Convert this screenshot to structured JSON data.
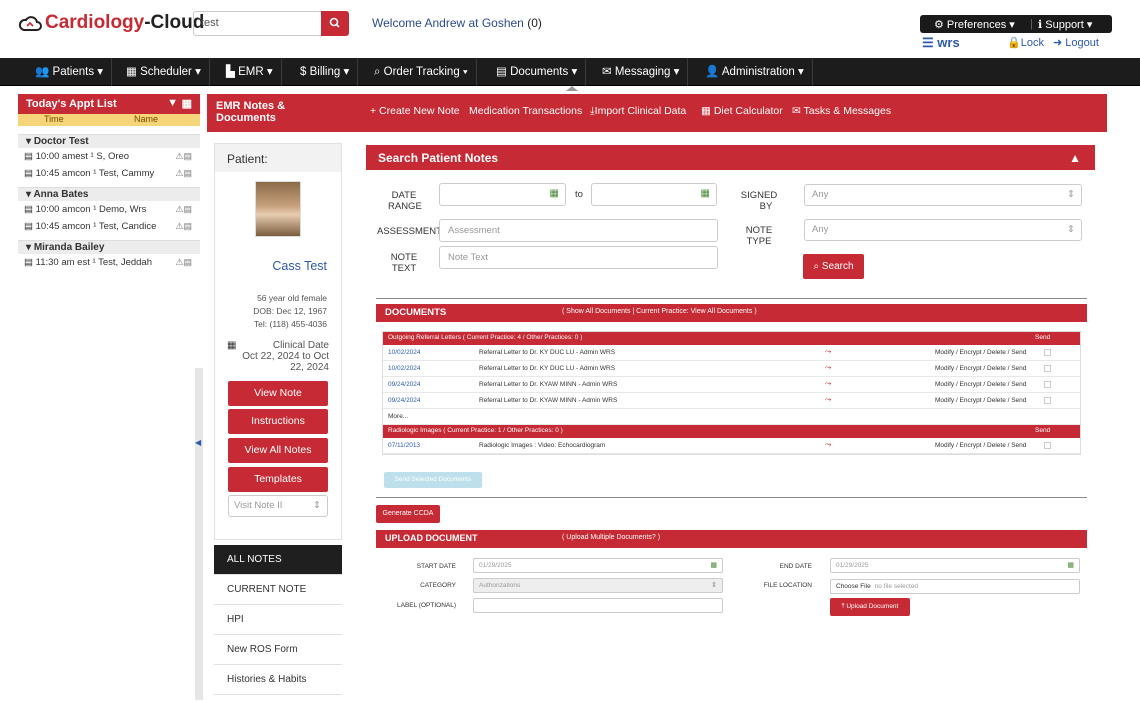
{
  "header": {
    "logo_part1": "Cardiology",
    "logo_part2": "-Cloud",
    "search_value": "test",
    "welcome": "Welcome Andrew at Goshen",
    "welcome_count": "(0)",
    "preferences": "Preferences",
    "support": "Support",
    "wrs": "wrs",
    "lock": "Lock",
    "logout": "Logout"
  },
  "nav": {
    "items": [
      {
        "label": "Patients",
        "icon": "patients-icon"
      },
      {
        "label": "Scheduler",
        "icon": "calendar-icon"
      },
      {
        "label": "EMR",
        "icon": "emr-icon"
      },
      {
        "label": "$ Billing",
        "icon": ""
      },
      {
        "label": "Order Tracking",
        "icon": "search-icon"
      },
      {
        "label": "Documents",
        "icon": "document-icon"
      },
      {
        "label": "Messaging",
        "icon": "envelope-icon"
      },
      {
        "label": "Administration",
        "icon": "user-icon"
      }
    ]
  },
  "appt": {
    "title": "Today's Appt List",
    "col_time": "Time",
    "col_name": "Name",
    "groups": [
      {
        "doctor": "Doctor Test",
        "rows": [
          "10:00 amest ¹ S, Oreo",
          "10:45 amcon ¹ Test, Cammy"
        ]
      },
      {
        "doctor": "Anna Bates",
        "rows": [
          "10:00 amcon ¹ Demo, Wrs",
          "10:45 amcon ¹ Test, Candice"
        ]
      },
      {
        "doctor": "Miranda Bailey",
        "rows": [
          "11:30 am est ¹ Test, Jeddah"
        ]
      }
    ]
  },
  "emr": {
    "title_line1": "EMR Notes &",
    "title_line2": "Documents",
    "create_note": "+ Create New Note",
    "med_transactions": "Medication Transactions",
    "import_clinical": "Import Clinical Data",
    "diet_calculator": "Diet Calculator",
    "tasks_messages": "Tasks & Messages"
  },
  "patient": {
    "label": "Patient:",
    "name": "Cass Test",
    "age_sex": "56 year old female",
    "dob": "DOB: Dec 12, 1967",
    "tel": "Tel: (118) 455-4036",
    "clinical_label": "Clinical Date",
    "clinical_range1": "Oct 22, 2024 to Oct",
    "clinical_range2": "22, 2024",
    "buttons": [
      "View Note",
      "Instructions",
      "View All Notes",
      "Templates"
    ],
    "visit_select": "Visit Note II"
  },
  "notes_list": [
    "ALL NOTES",
    "CURRENT NOTE",
    "HPI",
    "New ROS Form",
    "Histories & Habits"
  ],
  "search": {
    "title": "Search Patient Notes",
    "date_label1": "DATE",
    "date_label2": "RANGE",
    "to": "to",
    "assessment_label": "ASSESSMENT",
    "assessment_placeholder": "Assessment",
    "note_label1": "NOTE",
    "note_label2": "TEXT",
    "note_placeholder": "Note Text",
    "signed_label1": "SIGNED",
    "signed_label2": "BY",
    "signed_value": "Any",
    "type_label1": "NOTE",
    "type_label2": "TYPE",
    "type_value": "Any",
    "search_btn": "Search"
  },
  "documents": {
    "title": "DOCUMENTS",
    "sub": "( Show All Documents | Current Practice: View All Documents )",
    "section1": "Outgoing Referral Letters ( Current Practice: 4 / Other Practices: 0 )",
    "send": "Send",
    "rows": [
      {
        "date": "10/02/2024",
        "name": "Referral Letter to Dr. KY DUC LU - Admin WRS",
        "acts": "Modify / Encrypt / Delete / Send"
      },
      {
        "date": "10/02/2024",
        "name": "Referral Letter to Dr. KY DUC LU - Admin WRS",
        "acts": "Modify / Encrypt / Delete / Send"
      },
      {
        "date": "09/24/2024",
        "name": "Referral Letter to Dr. KYAW MINN - Admin WRS",
        "acts": "Modify / Encrypt / Delete / Send"
      },
      {
        "date": "09/24/2024",
        "name": "Referral Letter to Dr. KYAW MINN - Admin WRS",
        "acts": "Modify / Encrypt / Delete / Send"
      }
    ],
    "more": "More...",
    "section2": "Radiologic Images ( Current Practice: 1 / Other Practices: 0 )",
    "rows2": [
      {
        "date": "07/11/2013",
        "name": "Radiologic Images : Video: Echocardiogram",
        "acts": "Modify / Encrypt / Delete / Send"
      }
    ],
    "send_selected": "Send Selected Documents",
    "generate_ccda": "Generate CCDA"
  },
  "upload": {
    "title": "UPLOAD DOCUMENT",
    "sub": "( Upload Multiple Documents? )",
    "start_label": "START DATE",
    "start_value": "01/29/2025",
    "end_label": "END DATE",
    "end_value": "01/29/2025",
    "category_label": "CATEGORY",
    "category_value": "Authorizations",
    "file_label": "FILE LOCATION",
    "choose_file": "Choose File",
    "no_file": "no file selected",
    "label_label": "LABEL (OPTIONAL)",
    "upload_btn": "Upload Document"
  },
  "colors": {
    "brand_red": "#c62a34",
    "nav_dark": "#1c1c1c",
    "link_blue": "#2d5aa8"
  }
}
